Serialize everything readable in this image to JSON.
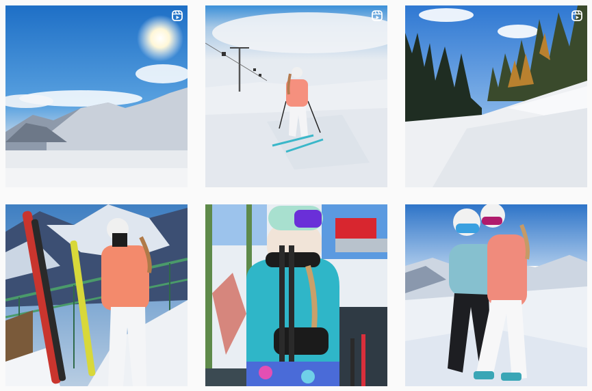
{
  "feed": {
    "posts": [
      {
        "type": "reel",
        "icon": "reel-icon"
      },
      {
        "type": "reel",
        "icon": "reel-icon"
      },
      {
        "type": "reel",
        "icon": "reel-icon"
      },
      {
        "type": "photo"
      },
      {
        "type": "photo"
      },
      {
        "type": "photo"
      }
    ]
  },
  "colors": {
    "background": "#fafafa",
    "sky": "#2f7fd0",
    "snow": "#eef1f5",
    "pink_jacket": "#f28a78",
    "turquoise_jacket": "#2fb6c8"
  }
}
